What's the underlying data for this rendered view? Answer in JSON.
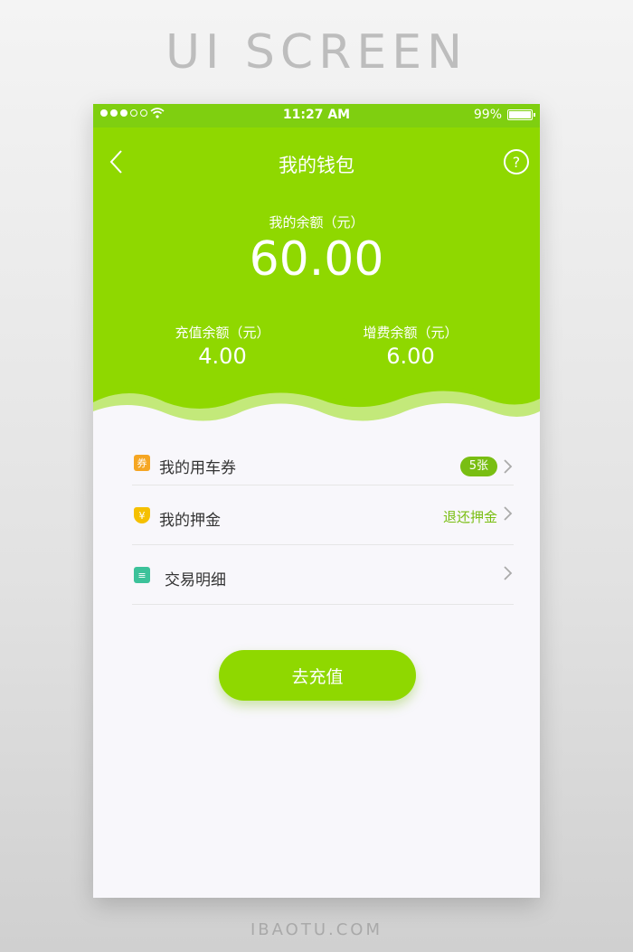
{
  "banner": {
    "title": "UI SCREEN",
    "footer": "IBAOTU.COM"
  },
  "status": {
    "time": "11:27 AM",
    "battery": "99%",
    "battery_level": 0.99
  },
  "nav": {
    "title": "我的钱包",
    "help": "?"
  },
  "balance": {
    "label": "我的余额（元）",
    "amount": "60.00",
    "recharge_label": "充值余额（元）",
    "recharge_value": "4.00",
    "bonus_label": "增费余额（元）",
    "bonus_value": "6.00"
  },
  "rows": [
    {
      "icon_glyph": "券",
      "icon_color": "#f5a623",
      "label": "我的用车券",
      "badge": "5张"
    },
    {
      "icon_glyph": "¥",
      "icon_color": "#f5c000",
      "label": "我的押金",
      "link": "退还押金"
    },
    {
      "icon_glyph": "≡",
      "icon_color": "#3cc29a",
      "label": "交易明细"
    }
  ],
  "cta": {
    "label": "去充值"
  },
  "colors": {
    "primary": "#8fd800",
    "accent_text": "#79be12"
  }
}
